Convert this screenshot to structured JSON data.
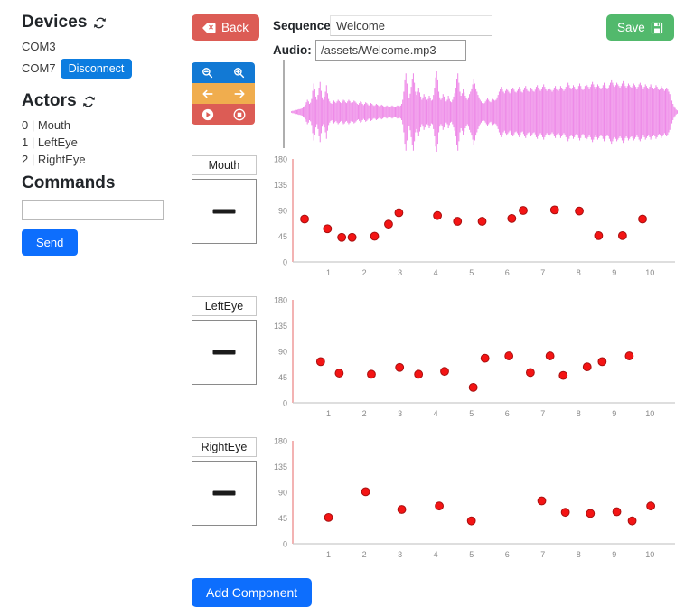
{
  "sidebar": {
    "devices": {
      "title": "Devices",
      "refresh_icon": "refresh-icon",
      "items": [
        {
          "port": "COM3",
          "action": null
        },
        {
          "port": "COM7",
          "action": "Disconnect"
        }
      ]
    },
    "actors": {
      "title": "Actors",
      "refresh_icon": "refresh-icon",
      "items": [
        "0 | Mouth",
        "1 | LeftEye",
        "2 | RightEye"
      ]
    },
    "commands": {
      "title": "Commands",
      "input_value": "",
      "input_placeholder": "",
      "send_label": "Send"
    }
  },
  "toolbar": {
    "back_label": "Back",
    "back_icon": "eraser-icon",
    "controls": [
      {
        "name": "zoom-out-icon",
        "row": 0,
        "col": 0
      },
      {
        "name": "zoom-in-icon",
        "row": 0,
        "col": 1
      },
      {
        "name": "arrow-left-icon",
        "row": 1,
        "col": 0
      },
      {
        "name": "arrow-right-icon",
        "row": 1,
        "col": 1
      },
      {
        "name": "play-icon",
        "row": 2,
        "col": 0
      },
      {
        "name": "stop-icon",
        "row": 2,
        "col": 1
      }
    ],
    "add_component_label": "Add Component"
  },
  "header": {
    "sequence_label": "Sequence:",
    "sequence_value": "Welcome",
    "sequence_placeholder": "",
    "audio_label": "Audio:",
    "audio_value": "/assets/Welcome.mp3",
    "audio_placeholder": "",
    "save_label": "Save",
    "save_icon": "floppy-disk-icon"
  },
  "colors": {
    "primary_blue": "#0d6efd",
    "danger_red": "#dc5c55",
    "warning_orange": "#f0ad4e",
    "success_green": "#52b96c",
    "waveform": "#ee8ae8",
    "point_fill": "#f41414",
    "point_stroke": "#a80f0f",
    "axis_y": "#f0a0a0",
    "axis_x": "#c9c9c9"
  },
  "components": [
    {
      "name_value": "Mouth",
      "preview_icon": "horizontal-bar-icon"
    },
    {
      "name_value": "LeftEye",
      "preview_icon": "horizontal-bar-icon"
    },
    {
      "name_value": "RightEye",
      "preview_icon": "horizontal-bar-icon"
    }
  ],
  "chart_data": [
    {
      "type": "scatter",
      "title": "Mouth",
      "xlabel": "",
      "ylabel": "",
      "xlim": [
        0,
        10.7
      ],
      "ylim": [
        0,
        180
      ],
      "yticks": [
        0,
        45,
        90,
        135,
        180
      ],
      "xticks": [
        1,
        2,
        3,
        4,
        5,
        6,
        7,
        8,
        9,
        10
      ],
      "grid": false,
      "legend": "none",
      "series": [
        {
          "name": "Mouth",
          "x": [
            0.33,
            0.97,
            1.37,
            1.66,
            2.29,
            2.68,
            2.97,
            4.05,
            4.61,
            5.3,
            6.13,
            6.45,
            7.33,
            8.02,
            8.56,
            9.23,
            9.79
          ],
          "y": [
            75,
            58,
            43,
            43,
            45,
            66,
            86,
            81,
            71,
            71,
            76,
            90,
            91,
            89,
            46,
            46,
            75
          ]
        }
      ]
    },
    {
      "type": "scatter",
      "title": "LeftEye",
      "xlabel": "",
      "ylabel": "",
      "xlim": [
        0,
        10.7
      ],
      "ylim": [
        0,
        180
      ],
      "yticks": [
        0,
        45,
        90,
        135,
        180
      ],
      "xticks": [
        1,
        2,
        3,
        4,
        5,
        6,
        7,
        8,
        9,
        10
      ],
      "grid": false,
      "legend": "none",
      "series": [
        {
          "name": "LeftEye",
          "x": [
            0.78,
            1.3,
            2.2,
            2.99,
            3.52,
            4.25,
            5.05,
            5.38,
            6.05,
            6.65,
            7.2,
            7.57,
            8.24,
            8.66,
            9.42
          ],
          "y": [
            72,
            52,
            50,
            62,
            50,
            55,
            27,
            78,
            82,
            53,
            82,
            48,
            63,
            72,
            82
          ]
        }
      ]
    },
    {
      "type": "scatter",
      "title": "RightEye",
      "xlabel": "",
      "ylabel": "",
      "xlim": [
        0,
        10.7
      ],
      "ylim": [
        0,
        180
      ],
      "yticks": [
        0,
        45,
        90,
        135,
        180
      ],
      "xticks": [
        1,
        2,
        3,
        4,
        5,
        6,
        7,
        8,
        9,
        10
      ],
      "grid": false,
      "legend": "none",
      "series": [
        {
          "name": "RightEye",
          "x": [
            1.0,
            2.04,
            3.05,
            4.1,
            5.0,
            6.97,
            7.63,
            8.33,
            9.07,
            9.5,
            10.02
          ],
          "y": [
            46,
            91,
            60,
            66,
            40,
            75,
            55,
            53,
            56,
            40,
            66
          ]
        }
      ]
    }
  ],
  "waveform": {
    "name": "audio-waveform",
    "color": "#ee8ae8",
    "peaks": [
      0.02,
      0.03,
      0.03,
      0.04,
      0.05,
      0.05,
      0.06,
      0.07,
      0.07,
      0.08,
      0.09,
      0.11,
      0.14,
      0.18,
      0.24,
      0.3,
      0.26,
      0.2,
      0.23,
      0.32,
      0.52,
      0.7,
      0.56,
      0.38,
      0.3,
      0.42,
      0.6,
      0.74,
      0.52,
      0.36,
      0.3,
      0.38,
      0.5,
      0.66,
      0.46,
      0.32,
      0.26,
      0.22,
      0.2,
      0.24,
      0.28,
      0.25,
      0.22,
      0.26,
      0.3,
      0.27,
      0.24,
      0.22,
      0.26,
      0.3,
      0.28,
      0.24,
      0.22,
      0.26,
      0.3,
      0.27,
      0.23,
      0.2,
      0.24,
      0.28,
      0.26,
      0.23,
      0.2,
      0.18,
      0.22,
      0.26,
      0.24,
      0.2,
      0.17,
      0.2,
      0.24,
      0.22,
      0.19,
      0.16,
      0.18,
      0.22,
      0.2,
      0.17,
      0.15,
      0.17,
      0.2,
      0.18,
      0.16,
      0.14,
      0.16,
      0.18,
      0.16,
      0.14,
      0.12,
      0.14,
      0.16,
      0.14,
      0.13,
      0.12,
      0.14,
      0.16,
      0.14,
      0.13,
      0.12,
      0.14,
      0.16,
      0.15,
      0.14,
      0.16,
      0.2,
      0.3,
      0.5,
      0.78,
      0.95,
      0.7,
      0.45,
      0.35,
      0.45,
      0.62,
      0.8,
      0.95,
      0.72,
      0.5,
      0.42,
      0.5,
      0.6,
      0.48,
      0.38,
      0.3,
      0.36,
      0.44,
      0.38,
      0.3,
      0.26,
      0.32,
      0.4,
      0.34,
      0.28,
      0.3,
      0.42,
      0.6,
      0.85,
      1.0,
      0.78,
      0.5,
      0.36,
      0.3,
      0.35,
      0.44,
      0.38,
      0.3,
      0.26,
      0.3,
      0.4,
      0.32,
      0.26,
      0.24,
      0.3,
      0.38,
      0.46,
      0.6,
      0.82,
      0.95,
      0.72,
      0.5,
      0.4,
      0.46,
      0.56,
      0.48,
      0.4,
      0.34,
      0.3,
      0.36,
      0.44,
      0.5,
      0.58,
      0.68,
      0.8,
      0.7,
      0.58,
      0.5,
      0.42,
      0.36,
      0.3,
      0.26,
      0.22,
      0.2,
      0.22,
      0.26,
      0.3,
      0.34,
      0.3,
      0.26,
      0.24,
      0.28,
      0.32,
      0.3,
      0.28,
      0.3,
      0.36,
      0.42,
      0.5,
      0.56,
      0.62,
      0.56,
      0.5,
      0.46,
      0.52,
      0.58,
      0.54,
      0.5,
      0.46,
      0.5,
      0.56,
      0.6,
      0.55,
      0.5,
      0.48,
      0.52,
      0.58,
      0.62,
      0.56,
      0.5,
      0.48,
      0.54,
      0.6,
      0.64,
      0.58,
      0.52,
      0.5,
      0.55,
      0.6,
      0.56,
      0.52,
      0.5,
      0.55,
      0.62,
      0.66,
      0.6,
      0.55,
      0.52,
      0.56,
      0.62,
      0.68,
      0.62,
      0.56,
      0.52,
      0.56,
      0.62,
      0.58,
      0.54,
      0.5,
      0.54,
      0.6,
      0.64,
      0.58,
      0.54,
      0.52,
      0.58,
      0.64,
      0.6,
      0.56,
      0.52,
      0.56,
      0.62,
      0.68,
      0.72,
      0.66,
      0.6,
      0.56,
      0.6,
      0.66,
      0.62,
      0.58,
      0.54,
      0.58,
      0.64,
      0.7,
      0.64,
      0.58,
      0.54,
      0.58,
      0.64,
      0.7,
      0.66,
      0.62,
      0.58,
      0.62,
      0.68,
      0.74,
      0.68,
      0.62,
      0.58,
      0.62,
      0.68,
      0.64,
      0.6,
      0.56,
      0.6,
      0.66,
      0.72,
      0.66,
      0.6,
      0.56,
      0.6,
      0.66,
      0.72,
      0.78,
      0.72,
      0.66,
      0.62,
      0.66,
      0.72,
      0.68,
      0.64,
      0.6,
      0.64,
      0.7,
      0.76,
      0.7,
      0.64,
      0.6,
      0.64,
      0.7,
      0.66,
      0.62,
      0.6,
      0.64,
      0.7,
      0.66,
      0.62,
      0.58,
      0.62,
      0.68,
      0.72,
      0.66,
      0.62,
      0.58,
      0.62,
      0.68,
      0.64,
      0.6,
      0.58,
      0.62,
      0.68,
      0.64,
      0.6,
      0.56,
      0.6,
      0.66,
      0.62,
      0.58,
      0.54,
      0.58,
      0.64,
      0.6,
      0.56,
      0.52,
      0.56,
      0.6,
      0.56,
      0.5,
      0.44,
      0.36,
      0.28,
      0.2,
      0.14,
      0.1,
      0.06,
      0.04
    ]
  }
}
